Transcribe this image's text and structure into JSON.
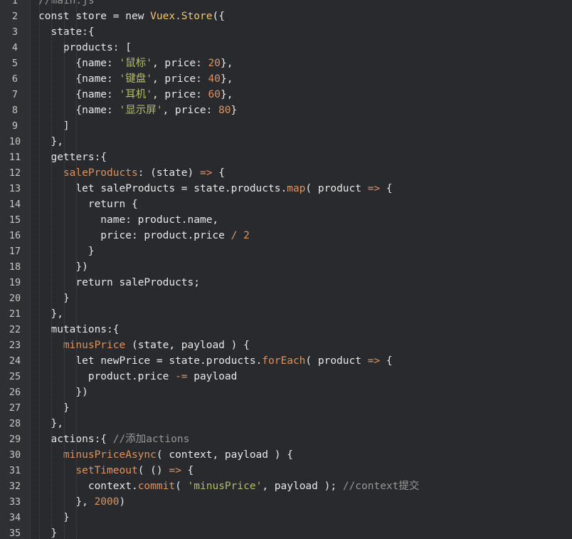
{
  "theme": {
    "background": "#282a2e",
    "gutter_background": "#2f3033",
    "line_number": "#c5c8c6",
    "colors": {
      "p": "#e8e8e8",
      "k": "#e8e8e8",
      "s": "#b5bd68",
      "n": "#de935f",
      "f": "#f0c674",
      "op": "#de935f",
      "c": "#969896",
      "fn": "#de935f",
      "m": "#de935f"
    }
  },
  "editor": {
    "lines": [
      {
        "n": "1",
        "tokens": [
          {
            "t": "c",
            "v": "//main.js"
          }
        ]
      },
      {
        "n": "2",
        "tokens": [
          {
            "t": "k",
            "v": "const "
          },
          {
            "t": "p",
            "v": "store = "
          },
          {
            "t": "k",
            "v": "new "
          },
          {
            "t": "f",
            "v": "Vuex.Store"
          },
          {
            "t": "p",
            "v": "({"
          }
        ]
      },
      {
        "n": "3",
        "tokens": [
          {
            "t": "p",
            "v": "  state:{"
          }
        ]
      },
      {
        "n": "4",
        "tokens": [
          {
            "t": "p",
            "v": "    products: ["
          }
        ]
      },
      {
        "n": "5",
        "tokens": [
          {
            "t": "p",
            "v": "      {name: "
          },
          {
            "t": "s",
            "v": "'鼠标'"
          },
          {
            "t": "p",
            "v": ", price: "
          },
          {
            "t": "n",
            "v": "20"
          },
          {
            "t": "p",
            "v": "},"
          }
        ]
      },
      {
        "n": "6",
        "tokens": [
          {
            "t": "p",
            "v": "      {name: "
          },
          {
            "t": "s",
            "v": "'键盘'"
          },
          {
            "t": "p",
            "v": ", price: "
          },
          {
            "t": "n",
            "v": "40"
          },
          {
            "t": "p",
            "v": "},"
          }
        ]
      },
      {
        "n": "7",
        "tokens": [
          {
            "t": "p",
            "v": "      {name: "
          },
          {
            "t": "s",
            "v": "'耳机'"
          },
          {
            "t": "p",
            "v": ", price: "
          },
          {
            "t": "n",
            "v": "60"
          },
          {
            "t": "p",
            "v": "},"
          }
        ]
      },
      {
        "n": "8",
        "tokens": [
          {
            "t": "p",
            "v": "      {name: "
          },
          {
            "t": "s",
            "v": "'显示屏'"
          },
          {
            "t": "p",
            "v": ", price: "
          },
          {
            "t": "n",
            "v": "80"
          },
          {
            "t": "p",
            "v": "}"
          }
        ]
      },
      {
        "n": "9",
        "tokens": [
          {
            "t": "p",
            "v": "    ]"
          }
        ]
      },
      {
        "n": "10",
        "tokens": [
          {
            "t": "p",
            "v": "  },"
          }
        ]
      },
      {
        "n": "11",
        "tokens": [
          {
            "t": "p",
            "v": "  getters:{"
          }
        ]
      },
      {
        "n": "12",
        "tokens": [
          {
            "t": "p",
            "v": "    "
          },
          {
            "t": "fn",
            "v": "saleProducts"
          },
          {
            "t": "p",
            "v": ": (state) "
          },
          {
            "t": "op",
            "v": "=>"
          },
          {
            "t": "p",
            "v": " {"
          }
        ]
      },
      {
        "n": "13",
        "tokens": [
          {
            "t": "p",
            "v": "      "
          },
          {
            "t": "k",
            "v": "let "
          },
          {
            "t": "p",
            "v": "saleProducts = state.products."
          },
          {
            "t": "m",
            "v": "map"
          },
          {
            "t": "p",
            "v": "( product "
          },
          {
            "t": "op",
            "v": "=>"
          },
          {
            "t": "p",
            "v": " {"
          }
        ]
      },
      {
        "n": "14",
        "tokens": [
          {
            "t": "p",
            "v": "        "
          },
          {
            "t": "k",
            "v": "return"
          },
          {
            "t": "p",
            "v": " {"
          }
        ]
      },
      {
        "n": "15",
        "tokens": [
          {
            "t": "p",
            "v": "          name: product.name,"
          }
        ]
      },
      {
        "n": "16",
        "tokens": [
          {
            "t": "p",
            "v": "          price: product.price "
          },
          {
            "t": "op",
            "v": "/"
          },
          {
            "t": "p",
            "v": " "
          },
          {
            "t": "n",
            "v": "2"
          }
        ]
      },
      {
        "n": "17",
        "tokens": [
          {
            "t": "p",
            "v": "        }"
          }
        ]
      },
      {
        "n": "18",
        "tokens": [
          {
            "t": "p",
            "v": "      })"
          }
        ]
      },
      {
        "n": "19",
        "tokens": [
          {
            "t": "p",
            "v": "      "
          },
          {
            "t": "k",
            "v": "return "
          },
          {
            "t": "p",
            "v": "saleProducts;"
          }
        ]
      },
      {
        "n": "20",
        "tokens": [
          {
            "t": "p",
            "v": "    }"
          }
        ]
      },
      {
        "n": "21",
        "tokens": [
          {
            "t": "p",
            "v": "  },"
          }
        ]
      },
      {
        "n": "22",
        "tokens": [
          {
            "t": "p",
            "v": "  mutations:{"
          }
        ]
      },
      {
        "n": "23",
        "tokens": [
          {
            "t": "p",
            "v": "    "
          },
          {
            "t": "fn",
            "v": "minusPrice"
          },
          {
            "t": "p",
            "v": " (state, payload ) {"
          }
        ]
      },
      {
        "n": "24",
        "tokens": [
          {
            "t": "p",
            "v": "      "
          },
          {
            "t": "k",
            "v": "let "
          },
          {
            "t": "p",
            "v": "newPrice = state.products."
          },
          {
            "t": "m",
            "v": "forEach"
          },
          {
            "t": "p",
            "v": "( product "
          },
          {
            "t": "op",
            "v": "=>"
          },
          {
            "t": "p",
            "v": " {"
          }
        ]
      },
      {
        "n": "25",
        "tokens": [
          {
            "t": "p",
            "v": "        product.price "
          },
          {
            "t": "op",
            "v": "-="
          },
          {
            "t": "p",
            "v": " payload"
          }
        ]
      },
      {
        "n": "26",
        "tokens": [
          {
            "t": "p",
            "v": "      })"
          }
        ]
      },
      {
        "n": "27",
        "tokens": [
          {
            "t": "p",
            "v": "    }"
          }
        ]
      },
      {
        "n": "28",
        "tokens": [
          {
            "t": "p",
            "v": "  },"
          }
        ]
      },
      {
        "n": "29",
        "tokens": [
          {
            "t": "p",
            "v": "  actions:{ "
          },
          {
            "t": "c",
            "v": "//添加actions"
          }
        ]
      },
      {
        "n": "30",
        "tokens": [
          {
            "t": "p",
            "v": "    "
          },
          {
            "t": "fn",
            "v": "minusPriceAsync"
          },
          {
            "t": "p",
            "v": "( context, payload ) {"
          }
        ]
      },
      {
        "n": "31",
        "tokens": [
          {
            "t": "p",
            "v": "      "
          },
          {
            "t": "m",
            "v": "setTimeout"
          },
          {
            "t": "p",
            "v": "( () "
          },
          {
            "t": "op",
            "v": "=>"
          },
          {
            "t": "p",
            "v": " {"
          }
        ]
      },
      {
        "n": "32",
        "tokens": [
          {
            "t": "p",
            "v": "        context."
          },
          {
            "t": "m",
            "v": "commit"
          },
          {
            "t": "p",
            "v": "( "
          },
          {
            "t": "s",
            "v": "'minusPrice'"
          },
          {
            "t": "p",
            "v": ", payload ); "
          },
          {
            "t": "c",
            "v": "//context提交"
          }
        ]
      },
      {
        "n": "33",
        "tokens": [
          {
            "t": "p",
            "v": "      }, "
          },
          {
            "t": "n",
            "v": "2000"
          },
          {
            "t": "p",
            "v": ")"
          }
        ]
      },
      {
        "n": "34",
        "tokens": [
          {
            "t": "p",
            "v": "    }"
          }
        ]
      },
      {
        "n": "35",
        "tokens": [
          {
            "t": "p",
            "v": "  }"
          }
        ]
      }
    ]
  }
}
